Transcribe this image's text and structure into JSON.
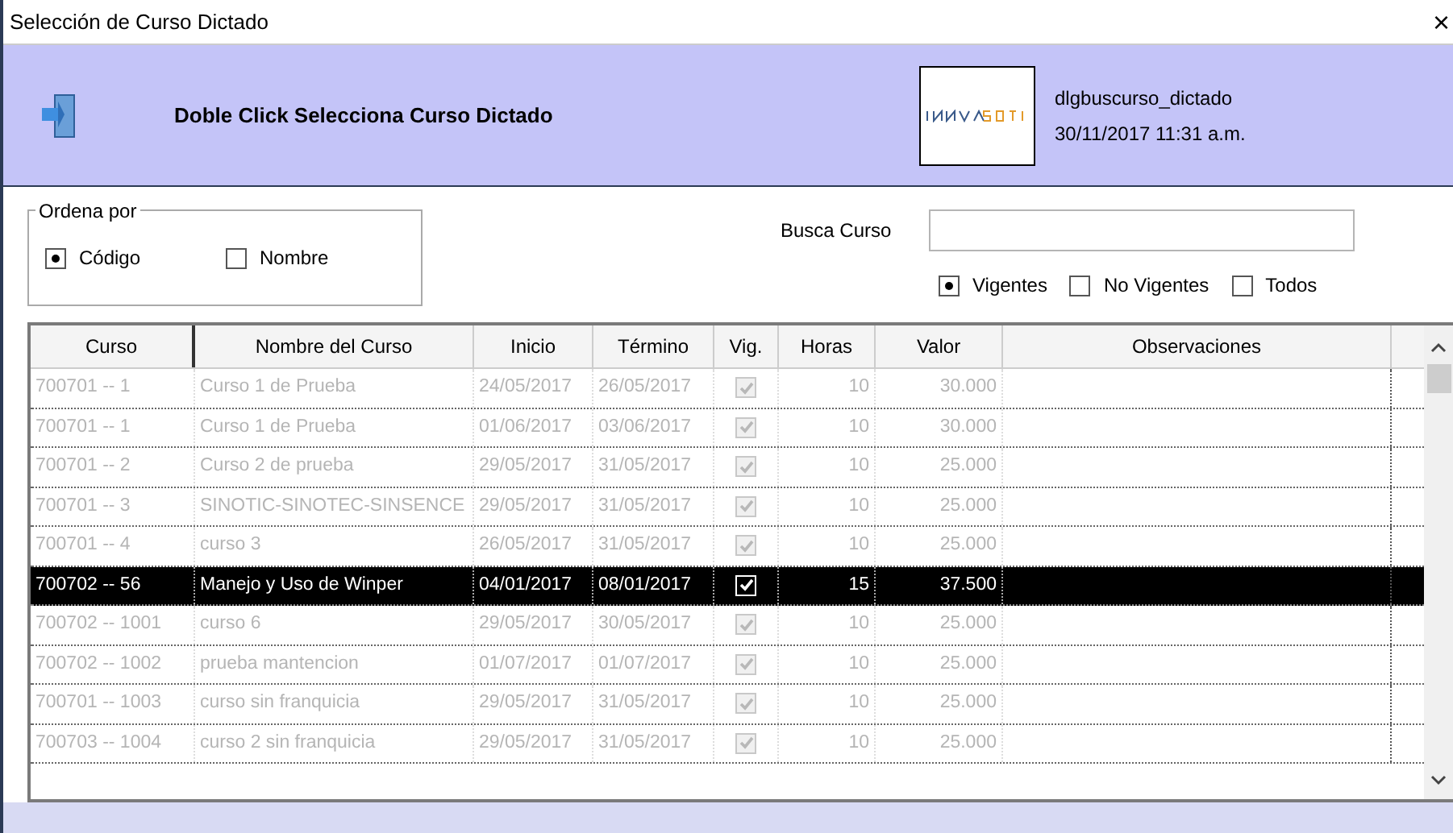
{
  "window": {
    "title": "Selección de Curso Dictado",
    "close": "×"
  },
  "header": {
    "message": "Doble Click Selecciona Curso Dictado",
    "dialog_name": "dlgbuscurso_dictado",
    "datetime": "30/11/2017 11:31 a.m."
  },
  "sort": {
    "legend": "Ordena por",
    "options": [
      {
        "label": "Código",
        "selected": true
      },
      {
        "label": "Nombre",
        "selected": false
      }
    ]
  },
  "search": {
    "label": "Busca Curso"
  },
  "filters": [
    {
      "label": "Vigentes",
      "selected": true
    },
    {
      "label": "No Vigentes",
      "selected": false
    },
    {
      "label": "Todos",
      "selected": false
    }
  ],
  "table": {
    "columns": [
      "Curso",
      "Nombre del Curso",
      "Inicio",
      "Término",
      "Vig.",
      "Horas",
      "Valor",
      "Observaciones"
    ],
    "rows": [
      {
        "curso": "700701 -- 1",
        "nombre": "Curso 1 de Prueba",
        "inicio": "24/05/2017",
        "termino": "26/05/2017",
        "vig": true,
        "horas": "10",
        "valor": "30.000",
        "selected": false
      },
      {
        "curso": "700701 -- 1",
        "nombre": "Curso 1 de Prueba",
        "inicio": "01/06/2017",
        "termino": "03/06/2017",
        "vig": true,
        "horas": "10",
        "valor": "30.000",
        "selected": false
      },
      {
        "curso": "700701 -- 2",
        "nombre": "Curso 2 de prueba",
        "inicio": "29/05/2017",
        "termino": "31/05/2017",
        "vig": true,
        "horas": "10",
        "valor": "25.000",
        "selected": false
      },
      {
        "curso": "700701 -- 3",
        "nombre": "SINOTIC-SINOTEC-SINSENCE",
        "inicio": "29/05/2017",
        "termino": "31/05/2017",
        "vig": true,
        "horas": "10",
        "valor": "25.000",
        "selected": false
      },
      {
        "curso": "700701 -- 4",
        "nombre": "curso 3",
        "inicio": "26/05/2017",
        "termino": "31/05/2017",
        "vig": true,
        "horas": "10",
        "valor": "25.000",
        "selected": false
      },
      {
        "curso": "700702 -- 56",
        "nombre": "Manejo y Uso de Winper",
        "inicio": "04/01/2017",
        "termino": "08/01/2017",
        "vig": true,
        "horas": "15",
        "valor": "37.500",
        "selected": true
      },
      {
        "curso": "700702 -- 1001",
        "nombre": "curso 6",
        "inicio": "29/05/2017",
        "termino": "30/05/2017",
        "vig": true,
        "horas": "10",
        "valor": "25.000",
        "selected": false
      },
      {
        "curso": "700702 -- 1002",
        "nombre": "prueba mantencion",
        "inicio": "01/07/2017",
        "termino": "01/07/2017",
        "vig": true,
        "horas": "10",
        "valor": "25.000",
        "selected": false
      },
      {
        "curso": "700701 -- 1003",
        "nombre": "curso sin franquicia",
        "inicio": "29/05/2017",
        "termino": "31/05/2017",
        "vig": true,
        "horas": "10",
        "valor": "25.000",
        "selected": false
      },
      {
        "curso": "700703 -- 1004",
        "nombre": "curso 2 sin franquicia",
        "inicio": "29/05/2017",
        "termino": "31/05/2017",
        "vig": true,
        "horas": "10",
        "valor": "25.000",
        "selected": false
      }
    ]
  }
}
